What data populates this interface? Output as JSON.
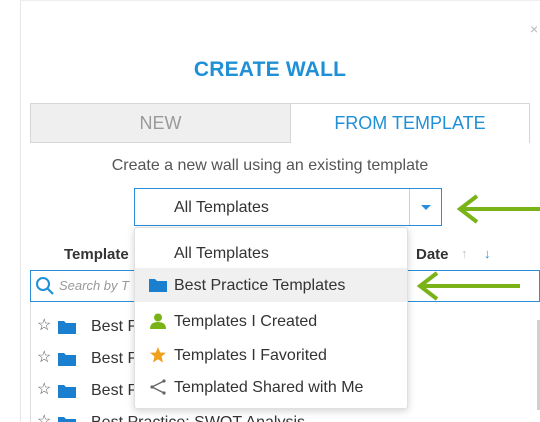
{
  "dialog": {
    "title": "CREATE WALL",
    "close_glyph": "×",
    "tabs": [
      {
        "label": "NEW",
        "active": false
      },
      {
        "label": "FROM TEMPLATE",
        "active": true
      }
    ],
    "subtitle": "Create a new wall using an existing template"
  },
  "filter": {
    "selected": "All Templates",
    "options": [
      {
        "label": "All Templates",
        "icon": "none"
      },
      {
        "label": "Best Practice Templates",
        "icon": "folder-icon",
        "highlighted": true
      },
      {
        "label": "Templates I Created",
        "icon": "person-icon"
      },
      {
        "label": "Templates I Favorited",
        "icon": "star-icon"
      },
      {
        "label": "Templated Shared with Me",
        "icon": "share-icon"
      }
    ]
  },
  "table": {
    "col_template": "Template",
    "col_date": "Date",
    "sort_up_glyph": "↑",
    "sort_down_glyph": "↓",
    "search_placeholder": "Search by T",
    "rows": [
      {
        "label": "Best P"
      },
      {
        "label": "Best P"
      },
      {
        "label": "Best P"
      },
      {
        "label": "Best Practice: SWOT Analysis"
      }
    ]
  },
  "colors": {
    "accent": "#1f8fd6",
    "annotation_arrow": "#7ab317",
    "favorite_star": "#f0a019",
    "person": "#7ab317",
    "folder": "#1b7fd0"
  }
}
